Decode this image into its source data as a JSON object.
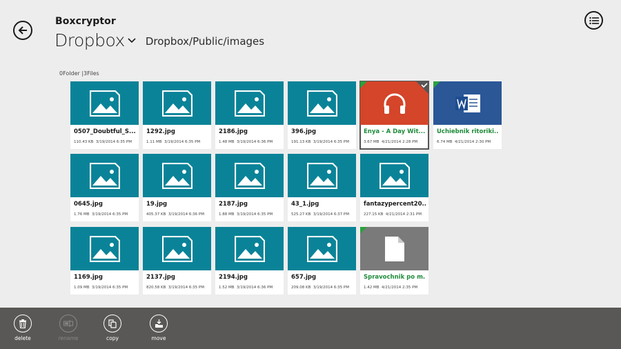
{
  "header": {
    "app_name": "Boxcryptor",
    "location_name": "Dropbox",
    "path": "Dropbox/Public/images"
  },
  "summary": "0Folder |3Files",
  "colors": {
    "tile_image": "#0a8398",
    "tile_audio": "#d4452a",
    "tile_word": "#2b5797",
    "tile_generic": "#7a7a7a",
    "sync_green": "#2aa13d"
  },
  "files": [
    {
      "name": "0507_Doubtful_S...",
      "size": "110.43 KB",
      "date": "3/19/2014 6:35 PM",
      "icon": "image-icon",
      "kind": "image",
      "synced": false,
      "selected": false
    },
    {
      "name": "1292.jpg",
      "size": "1.11 MB",
      "date": "3/19/2014 6:35 PM",
      "icon": "image-icon",
      "kind": "image",
      "synced": false,
      "selected": false
    },
    {
      "name": "2186.jpg",
      "size": "1.48 MB",
      "date": "3/19/2014 6:36 PM",
      "icon": "image-icon",
      "kind": "image",
      "synced": false,
      "selected": false
    },
    {
      "name": "396.jpg",
      "size": "191.13 KB",
      "date": "3/19/2014 6:35 PM",
      "icon": "image-icon",
      "kind": "image",
      "synced": false,
      "selected": false
    },
    {
      "name": "Enya - A Day Wit...",
      "size": "3.67 MB",
      "date": "4/21/2014 2:28 PM",
      "icon": "headphones-icon",
      "kind": "audio",
      "synced": true,
      "selected": true
    },
    {
      "name": "Uchiebnik ritoriki...",
      "size": "6.74 MB",
      "date": "4/21/2014 2:30 PM",
      "icon": "word-document-icon",
      "kind": "word",
      "synced": true,
      "selected": false
    },
    {
      "name": "0645.jpg",
      "size": "1.76 MB",
      "date": "3/19/2014 6:35 PM",
      "icon": "image-icon",
      "kind": "image",
      "synced": false,
      "selected": false
    },
    {
      "name": "19.jpg",
      "size": "405.37 KB",
      "date": "3/19/2014 6:36 PM",
      "icon": "image-icon",
      "kind": "image",
      "synced": false,
      "selected": false
    },
    {
      "name": "2187.jpg",
      "size": "1.88 MB",
      "date": "3/19/2014 6:35 PM",
      "icon": "image-icon",
      "kind": "image",
      "synced": false,
      "selected": false
    },
    {
      "name": "43_1.jpg",
      "size": "525.27 KB",
      "date": "3/19/2014 6:37 PM",
      "icon": "image-icon",
      "kind": "image",
      "synced": false,
      "selected": false
    },
    {
      "name": "fantazypercent20...",
      "size": "227.15 KB",
      "date": "4/21/2014 2:31 PM",
      "icon": "image-icon",
      "kind": "image",
      "synced": false,
      "selected": false
    },
    {
      "name": "1169.jpg",
      "size": "1.09 MB",
      "date": "3/19/2014 6:35 PM",
      "icon": "image-icon",
      "kind": "image",
      "synced": false,
      "selected": false
    },
    {
      "name": "2137.jpg",
      "size": "820.58 KB",
      "date": "3/19/2014 6:35 PM",
      "icon": "image-icon",
      "kind": "image",
      "synced": false,
      "selected": false
    },
    {
      "name": "2194.jpg",
      "size": "1.52 MB",
      "date": "3/19/2014 6:36 PM",
      "icon": "image-icon",
      "kind": "image",
      "synced": false,
      "selected": false
    },
    {
      "name": "657.jpg",
      "size": "209.08 KB",
      "date": "3/19/2014 6:35 PM",
      "icon": "image-icon",
      "kind": "image",
      "synced": false,
      "selected": false
    },
    {
      "name": "Spravochnik po m...",
      "size": "1.42 MB",
      "date": "4/21/2014 2:35 PM",
      "icon": "document-icon",
      "kind": "generic",
      "synced": true,
      "selected": false
    }
  ],
  "appbar": {
    "delete": "delete",
    "rename": "rename",
    "copy": "copy",
    "move": "move"
  }
}
